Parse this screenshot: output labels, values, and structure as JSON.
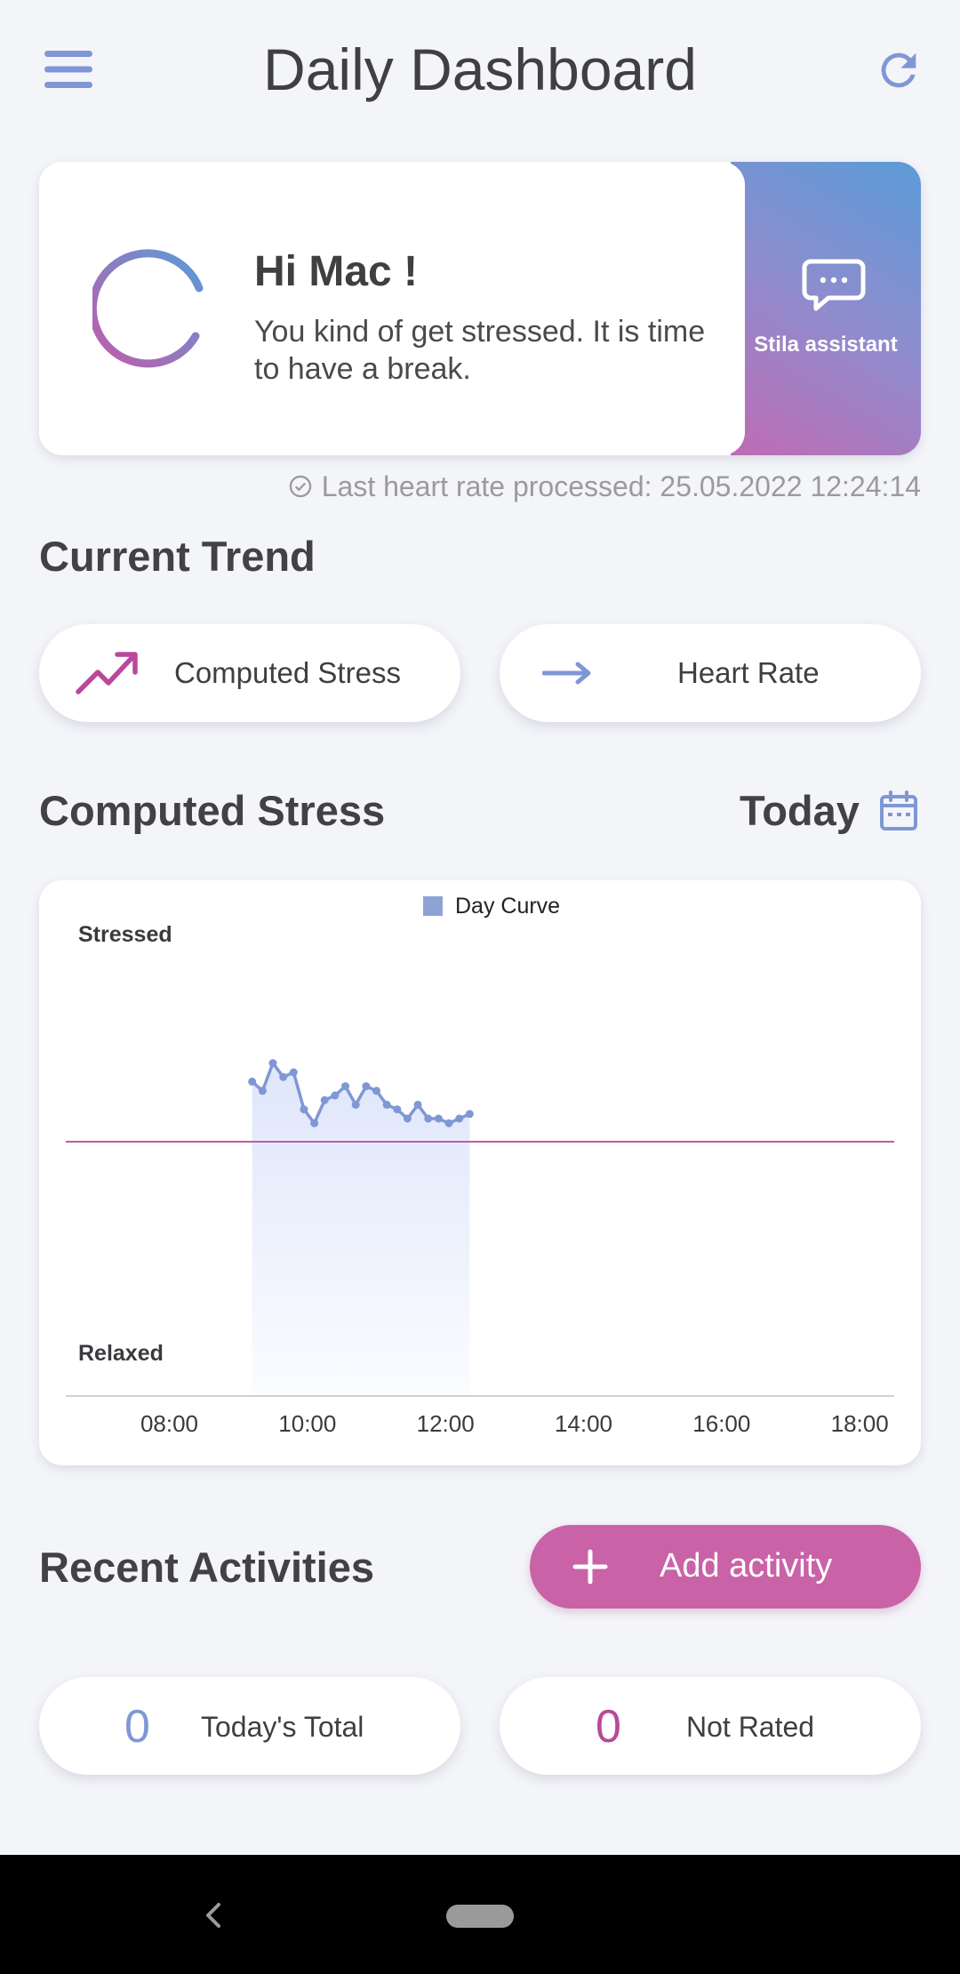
{
  "header": {
    "title": "Daily Dashboard",
    "menu_icon": "hamburger-menu-icon",
    "refresh_icon": "refresh-icon"
  },
  "greeting": {
    "title": "Hi Mac !",
    "message": "You kind of get stressed. It is time to have a break.",
    "assistant_label": "Stila assistant",
    "assistant_icon": "chat-bubble-icon"
  },
  "last_processed": {
    "text": "Last heart rate processed: 25.05.2022 12:24:14",
    "icon": "check-circle-icon"
  },
  "current_trend": {
    "title": "Current Trend",
    "items": [
      {
        "label": "Computed Stress",
        "icon": "trending-up-icon",
        "color": "#b9489a"
      },
      {
        "label": "Heart Rate",
        "icon": "arrow-right-icon",
        "color": "#7f97d4"
      }
    ]
  },
  "stress_section": {
    "title": "Computed Stress",
    "period": "Today",
    "calendar_icon": "calendar-icon"
  },
  "chart_data": {
    "type": "area",
    "legend": [
      "Day Curve"
    ],
    "legend_placement": "top-center",
    "y_top_label": "Stressed",
    "y_bottom_label": "Relaxed",
    "x_tick_labels": [
      "08:00",
      "10:00",
      "12:00",
      "14:00",
      "16:00",
      "18:00"
    ],
    "x_range": [
      6.5,
      18.5
    ],
    "y_range": [
      0,
      100
    ],
    "threshold": 55,
    "series": [
      {
        "name": "Day Curve",
        "color": "#7f97d4",
        "x": [
          9.2,
          9.35,
          9.5,
          9.65,
          9.8,
          9.95,
          10.1,
          10.25,
          10.4,
          10.55,
          10.7,
          10.85,
          11.0,
          11.15,
          11.3,
          11.45,
          11.6,
          11.75,
          11.9,
          12.05,
          12.2,
          12.35
        ],
        "y": [
          68,
          66,
          72,
          69,
          70,
          62,
          59,
          64,
          65,
          67,
          63,
          67,
          66,
          63,
          62,
          60,
          63,
          60,
          60,
          59,
          60,
          61
        ],
        "threshold_color": "#c25ba8"
      }
    ]
  },
  "recent": {
    "title": "Recent Activities",
    "add_button": "Add activity",
    "add_icon": "plus-icon",
    "button_color": "#c962a7",
    "stats": [
      {
        "value": "0",
        "label": "Today's Total",
        "color": "#7f97d4"
      },
      {
        "value": "0",
        "label": "Not Rated",
        "color": "#b9489a"
      }
    ]
  },
  "system_nav": {
    "back_icon": "back-chevron-icon",
    "home_icon": "home-pill-icon"
  }
}
